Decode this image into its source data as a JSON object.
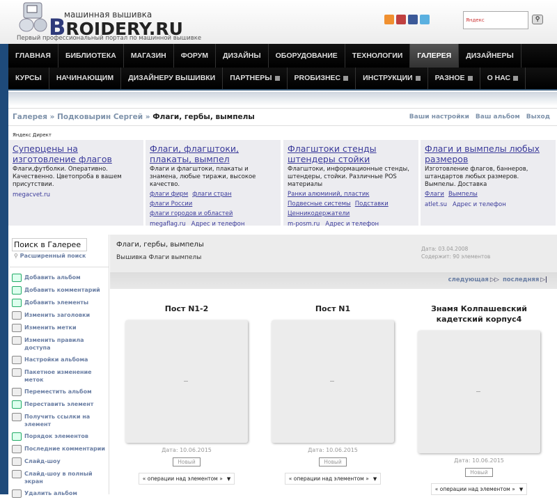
{
  "header": {
    "logo_small": "машинная вышивка",
    "logo_text": "ROIDERY.RU",
    "logo_initial": "B",
    "tagline": "Первый профессиональный портал по машинной вышивке",
    "social": [
      {
        "icon": "blogger-icon",
        "color": "#f09030"
      },
      {
        "icon": "youtube-icon",
        "color": "#c04040"
      },
      {
        "icon": "facebook-icon",
        "color": "#3b5998"
      },
      {
        "icon": "twitter-icon",
        "color": "#5ab0e0"
      }
    ],
    "search_placeholder": "Яндекс"
  },
  "nav_row1": [
    {
      "label": "ГЛАВНАЯ"
    },
    {
      "label": "БИБЛИОТЕКА"
    },
    {
      "label": "МАГАЗИН"
    },
    {
      "label": "ФОРУМ"
    },
    {
      "label": "ДИЗАЙНЫ"
    },
    {
      "label": "ОБОРУДОВАНИЕ"
    },
    {
      "label": "ТЕХНОЛОГИИ"
    },
    {
      "label": "ГАЛЕРЕЯ",
      "active": true
    },
    {
      "label": "ДИЗАЙНЕРЫ"
    }
  ],
  "nav_row2": [
    {
      "label": "КУРСЫ"
    },
    {
      "label": "НАЧИНАЮЩИМ"
    },
    {
      "label": "ДИЗАЙНЕРУ ВЫШИВКИ"
    },
    {
      "label": "ПАРТНЕРЫ"
    },
    {
      "label": "PROБИЗНЕС"
    },
    {
      "label": "ИНСТРУКЦИИ"
    },
    {
      "label": "РАЗНОЕ"
    },
    {
      "label": "О НАС"
    }
  ],
  "breadcrumb": {
    "items": [
      "Галерея",
      "Подковырин Сергей"
    ],
    "current": "Флаги, гербы, вымпелы",
    "sep": "»"
  },
  "user_links": [
    "Ваши настройки",
    "Ваш альбом",
    "Выход"
  ],
  "ads": {
    "label": "Яндекс Директ",
    "items": [
      {
        "title": "Суперцены на изготовление флагов",
        "text": "Флаги,футболки. Оперативно. Качественно. Цветопроба в вашем присутствии.",
        "links": [],
        "domain": "megacvet.ru",
        "contact": ""
      },
      {
        "title": "Флаги, флагштоки, плакаты, вымпел",
        "text": "Флаги и флагштоки, плакаты и знамена, любые тиражи, высокое качество.",
        "links": [
          [
            "флаги фирм",
            "флаги стран"
          ],
          [
            "флаги России"
          ],
          [
            "флаги городов и областей"
          ]
        ],
        "domain": "megaflag.ru",
        "contact": "Адрес и телефон"
      },
      {
        "title": "Флагштоки стенды штендеры стойки",
        "text": "Флагштоки, информационные стенды, штендеры, стойки. Различные POS материалы",
        "links": [
          [
            "Ранки алюминий, пластик"
          ],
          [
            "Подвесные системы",
            "Подставки"
          ],
          [
            "Ценникодержатели"
          ]
        ],
        "domain": "m-posm.ru",
        "contact": "Адрес и телефон"
      },
      {
        "title": "Флаги и вымпелы любых размеров",
        "text": "Изготовление флагов, баннеров, штандартов любых размеров. Вымпелы. Доставка",
        "links": [
          [
            "Флаги",
            "Вымпелы"
          ]
        ],
        "domain": "atlet.su",
        "contact": "Адрес и телефон"
      }
    ]
  },
  "sidebar": {
    "search_value": "Поиск в Галерее",
    "advanced": "Расширенный поиск",
    "items": [
      {
        "label": "Добавить альбом",
        "icon": "add-album-icon"
      },
      {
        "label": "Добавить комментарий",
        "icon": "add-comment-icon"
      },
      {
        "label": "Добавить элементы",
        "icon": "add-items-icon"
      },
      {
        "label": "Изменить заголовки",
        "icon": "edit-captions-icon"
      },
      {
        "label": "Изменить метки",
        "icon": "checkbox-icon"
      },
      {
        "label": "Изменить правила доступа",
        "icon": "permissions-icon"
      },
      {
        "label": "Настройки альбома",
        "icon": "album-settings-icon"
      },
      {
        "label": "Пакетное изменение меток",
        "icon": "checkbox-icon"
      },
      {
        "label": "Переместить альбом",
        "icon": "move-album-icon"
      },
      {
        "label": "Переставить элемент",
        "icon": "reorder-icon"
      },
      {
        "label": "Получить ссылки на элемент",
        "icon": "checkbox-icon"
      },
      {
        "label": "Порядок элементов",
        "icon": "sort-icon"
      },
      {
        "label": "Последние комментарии",
        "icon": "search-comments-icon"
      },
      {
        "label": "Слайд-шоу",
        "icon": "checkbox-icon"
      },
      {
        "label": "Слайд-шоу в полный экран",
        "icon": "fullscreen-slideshow-icon"
      },
      {
        "label": "Удалить альбом",
        "icon": "delete-icon"
      }
    ]
  },
  "album": {
    "title": "Флаги, гербы, вымпелы",
    "description": "Вышивка Флаги вымпелы",
    "date": "Дата: 03.04.2008",
    "count": "Содержит: 90 элементов"
  },
  "pager": {
    "next": "следующая",
    "last": "последняя"
  },
  "items": [
    {
      "title": "Пост N1-2",
      "date": "Дата: 10.06.2015",
      "badge": "Новый",
      "ops": "« операции над элементом »"
    },
    {
      "title": "Пост N1",
      "date": "Дата: 10.06.2015",
      "badge": "Новый",
      "ops": "« операции над элементом »"
    },
    {
      "title": "Знамя Колпашевский кадетский корпус4",
      "date": "Дата: 10.06.2015",
      "badge": "Новый",
      "ops": "« операции над элементом »"
    }
  ]
}
